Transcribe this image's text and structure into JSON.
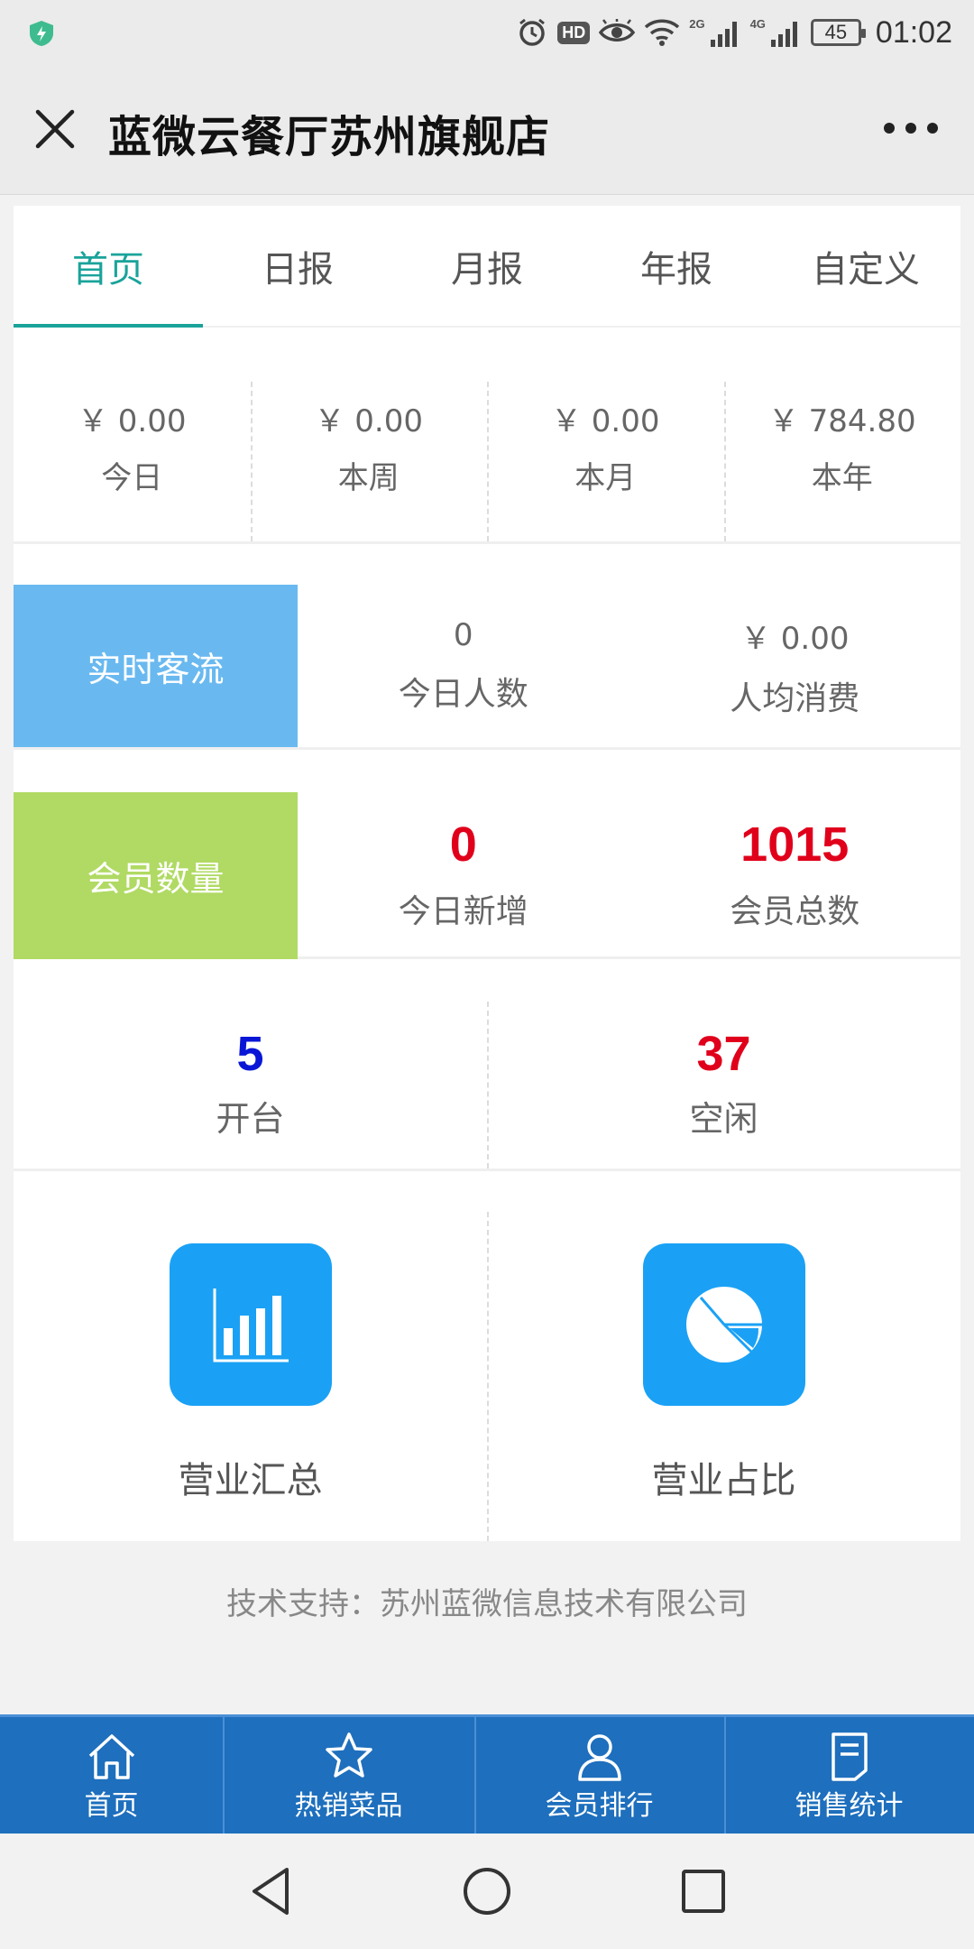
{
  "status_bar": {
    "time": "01:02",
    "battery": "45",
    "hd_badge": "HD",
    "net_2g": "2G",
    "net_4g": "4G",
    "icons": [
      "shield-icon",
      "alarm-icon",
      "hd-icon",
      "eye-icon",
      "wifi-icon",
      "signal-icon",
      "battery-icon"
    ]
  },
  "header": {
    "title": "蓝微云餐厅苏州旗舰店"
  },
  "tabs": [
    {
      "label": "首页",
      "active": true
    },
    {
      "label": "日报",
      "active": false
    },
    {
      "label": "月报",
      "active": false
    },
    {
      "label": "年报",
      "active": false
    },
    {
      "label": "自定义",
      "active": false
    }
  ],
  "revenue": [
    {
      "value": "￥ 0.00",
      "label": "今日"
    },
    {
      "value": "￥ 0.00",
      "label": "本周"
    },
    {
      "value": "￥ 0.00",
      "label": "本月"
    },
    {
      "value": "￥ 784.80",
      "label": "本年"
    }
  ],
  "traffic": {
    "label": "实时客流",
    "today_count": "0",
    "today_count_label": "今日人数",
    "avg_spend": "￥ 0.00",
    "avg_spend_label": "人均消费",
    "color": "#69b9f0"
  },
  "members": {
    "label": "会员数量",
    "new_today": "0",
    "new_today_label": "今日新增",
    "total": "1015",
    "total_label": "会员总数",
    "color": "#b0da63"
  },
  "tables": {
    "open": "5",
    "open_label": "开台",
    "idle": "37",
    "idle_label": "空闲"
  },
  "entries": [
    {
      "label": "营业汇总",
      "icon": "bar-chart-icon"
    },
    {
      "label": "营业占比",
      "icon": "pie-chart-icon"
    }
  ],
  "footer": {
    "note": "技术支持：苏州蓝微信息技术有限公司"
  },
  "bottom_nav": [
    {
      "label": "首页",
      "icon": "home-icon"
    },
    {
      "label": "热销菜品",
      "icon": "star-icon"
    },
    {
      "label": "会员排行",
      "icon": "user-icon"
    },
    {
      "label": "销售统计",
      "icon": "document-icon"
    }
  ],
  "colors": {
    "accent": "#1aa39a",
    "bottom_bar": "#1e6fbd",
    "entry_icon": "#1aa1f5",
    "highlight_red": "#e0001b",
    "highlight_blue": "#0a16d6"
  }
}
